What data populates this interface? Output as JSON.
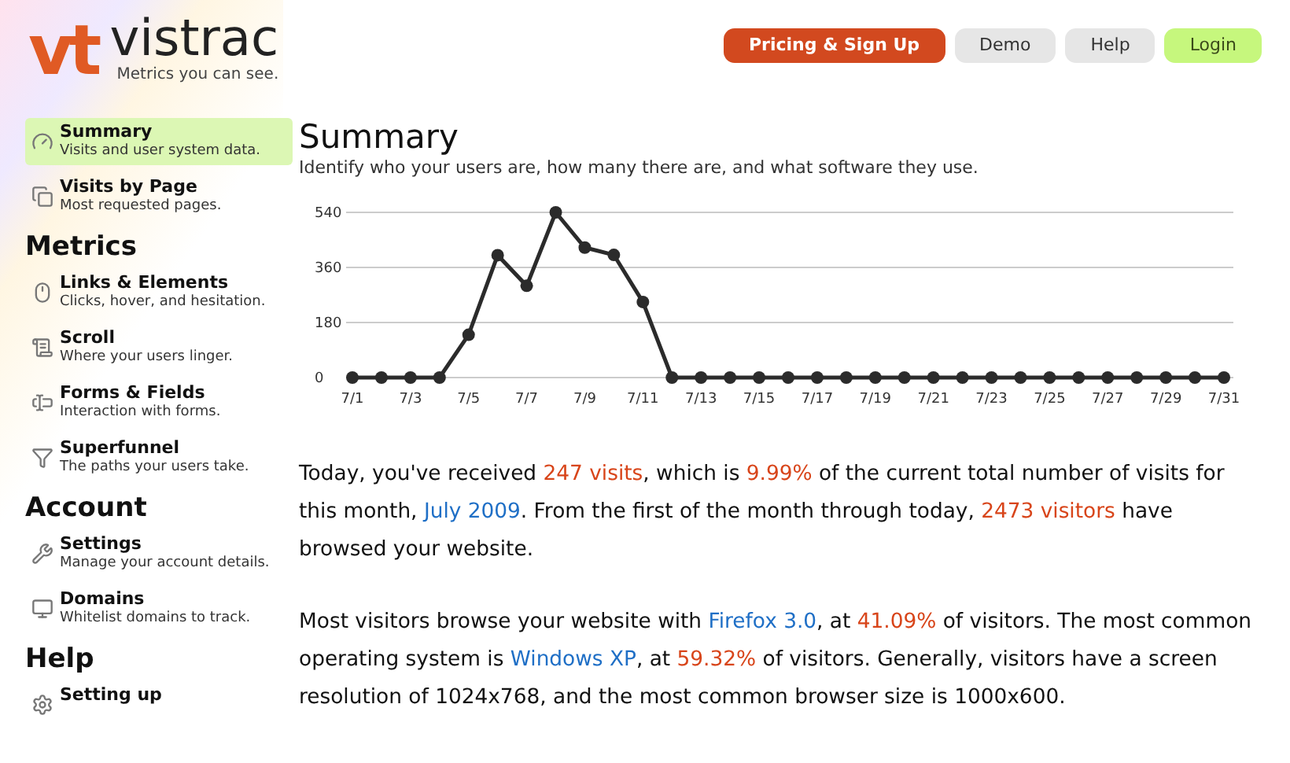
{
  "brand": {
    "mark": "vt",
    "name": "vistrac",
    "tagline": "Metrics you can see."
  },
  "nav": [
    {
      "label": "Pricing & Sign Up",
      "kind": "primary"
    },
    {
      "label": "Demo",
      "kind": "plain"
    },
    {
      "label": "Help",
      "kind": "plain"
    },
    {
      "label": "Login",
      "kind": "login"
    }
  ],
  "sidebar": [
    {
      "items": [
        {
          "title": "Summary",
          "desc": "Visits and user system data.",
          "selected": true
        },
        {
          "title": "Visits by Page",
          "desc": "Most requested pages.",
          "selected": false
        }
      ]
    },
    {
      "heading": "Metrics",
      "items": [
        {
          "title": "Links & Elements",
          "desc": "Clicks, hover, and hesitation.",
          "selected": false
        },
        {
          "title": "Scroll",
          "desc": "Where your users linger.",
          "selected": false
        },
        {
          "title": "Forms & Fields",
          "desc": "Interaction with forms.",
          "selected": false
        },
        {
          "title": "Superfunnel",
          "desc": "The paths your users take.",
          "selected": false
        }
      ]
    },
    {
      "heading": "Account",
      "items": [
        {
          "title": "Settings",
          "desc": "Manage your account details.",
          "selected": false
        },
        {
          "title": "Domains",
          "desc": "Whitelist domains to track.",
          "selected": false
        }
      ]
    },
    {
      "heading": "Help",
      "items": [
        {
          "title": "Setting up",
          "selected": false
        }
      ]
    }
  ],
  "main": {
    "title": "Summary",
    "subtitle": "Identify who your users are, how many there are, and what software they use.",
    "chart_data": {
      "type": "line",
      "categories": [
        "7/1",
        null,
        "7/3",
        null,
        "7/5",
        null,
        "7/7",
        null,
        "7/9",
        null,
        "7/11",
        null,
        "7/13",
        null,
        "7/15",
        null,
        "7/17",
        null,
        "7/19",
        null,
        "7/21",
        null,
        "7/23",
        null,
        "7/25",
        null,
        "7/27",
        null,
        "7/29",
        null,
        "7/31"
      ],
      "series": [
        {
          "color": "#2b2b2b",
          "marker": "circle",
          "values": [
            0,
            0,
            0,
            0,
            140,
            400,
            300,
            540,
            425,
            401,
            247,
            0,
            0,
            0,
            0,
            0,
            0,
            0,
            0,
            0,
            0,
            0,
            0,
            0,
            0,
            0,
            0,
            0,
            0,
            0,
            0
          ]
        }
      ],
      "yticks": [
        0,
        180,
        360,
        540
      ],
      "ylim": [
        0,
        540
      ],
      "grid": true
    },
    "paragraphs": [
      [
        {
          "text": "Today, you've received ",
          "kind": "plain"
        },
        {
          "text": "247 visits",
          "kind": "figure"
        },
        {
          "text": ", which is ",
          "kind": "plain"
        },
        {
          "text": "9.99%",
          "kind": "figure"
        },
        {
          "text": " of the current total number of visits for this month, ",
          "kind": "plain"
        },
        {
          "text": "July 2009",
          "kind": "link"
        },
        {
          "text": ". From the first of the month through today, ",
          "kind": "plain"
        },
        {
          "text": "2473 visitors",
          "kind": "figure"
        },
        {
          "text": " have browsed your website.",
          "kind": "plain"
        }
      ],
      [
        {
          "text": "Most visitors browse your website with ",
          "kind": "plain"
        },
        {
          "text": "Firefox 3.0",
          "kind": "link"
        },
        {
          "text": ", at ",
          "kind": "plain"
        },
        {
          "text": "41.09%",
          "kind": "figure"
        },
        {
          "text": " of visitors. The most common operating system is ",
          "kind": "plain"
        },
        {
          "text": "Windows XP",
          "kind": "link"
        },
        {
          "text": ", at ",
          "kind": "plain"
        },
        {
          "text": "59.32%",
          "kind": "figure"
        },
        {
          "text": " of visitors. Generally, visitors have a screen resolution of ",
          "kind": "plain"
        },
        {
          "text": "1024x768",
          "kind": "plain"
        },
        {
          "text": ", and the most common browser size is ",
          "kind": "plain"
        },
        {
          "text": "1000x600",
          "kind": "plain"
        },
        {
          "text": ".",
          "kind": "plain"
        }
      ]
    ]
  }
}
